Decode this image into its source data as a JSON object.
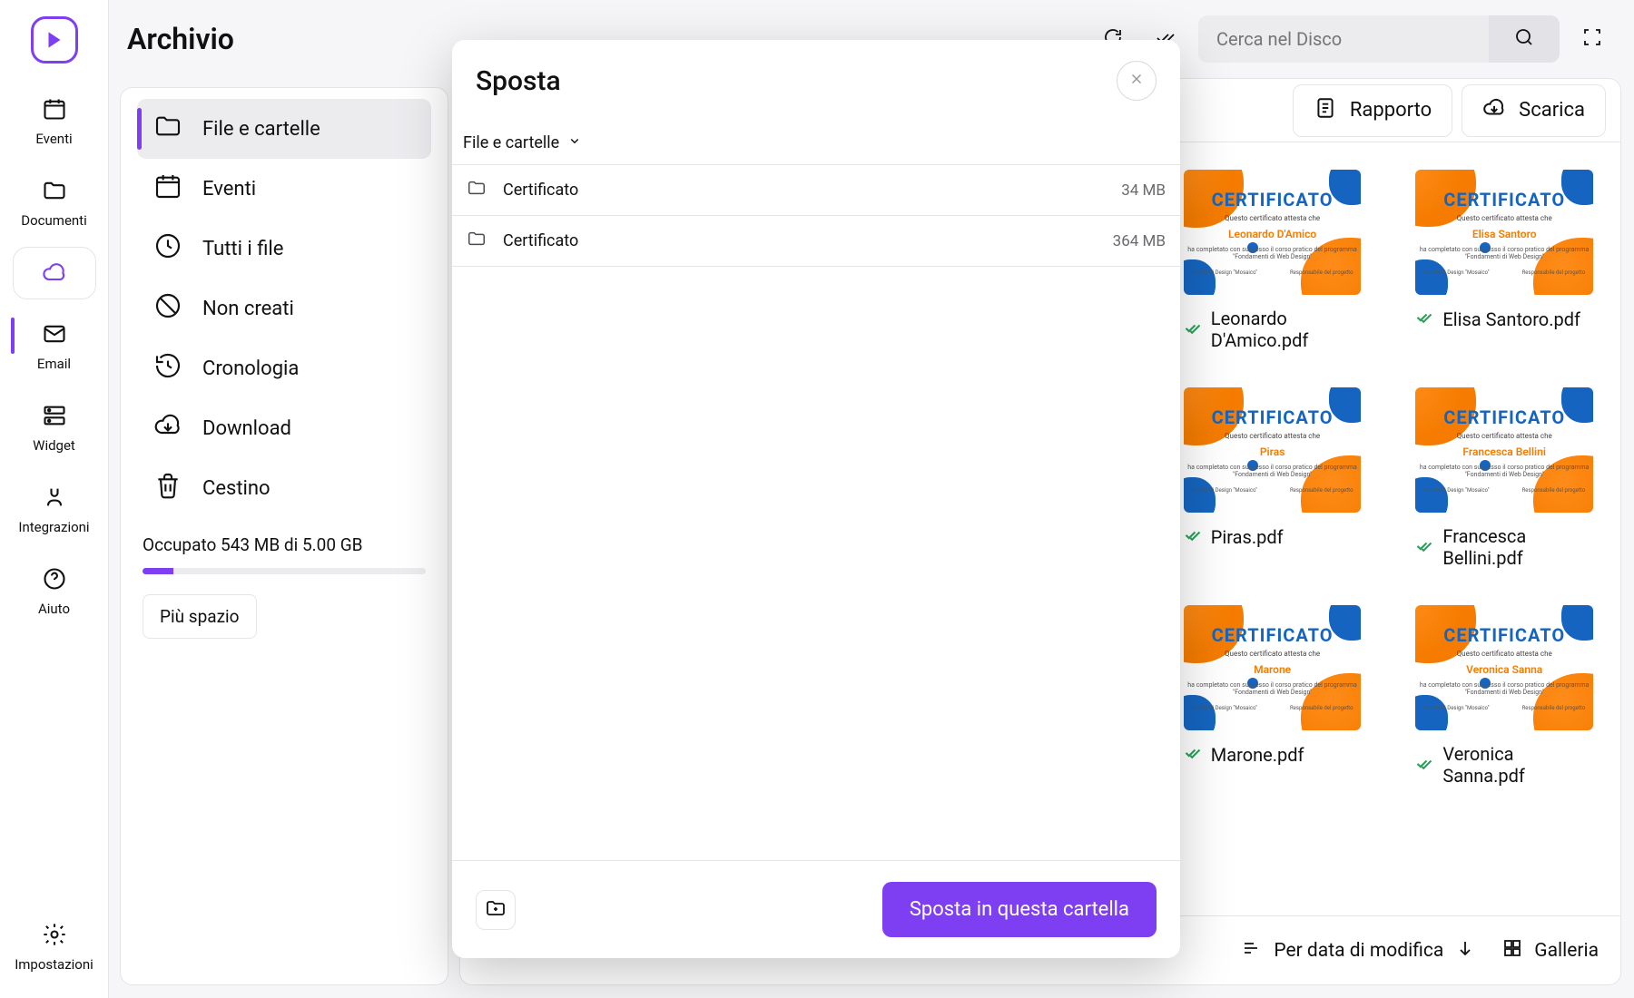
{
  "header": {
    "page_title": "Archivio",
    "search_placeholder": "Cerca nel Disco",
    "report_label": "Rapporto",
    "download_label": "Scarica"
  },
  "primary_nav": {
    "items": [
      {
        "key": "eventi",
        "label": "Eventi"
      },
      {
        "key": "documenti",
        "label": "Documenti"
      },
      {
        "key": "archivio",
        "label": ""
      },
      {
        "key": "email",
        "label": "Email"
      },
      {
        "key": "widget",
        "label": "Widget"
      },
      {
        "key": "integrazioni",
        "label": "Integrazioni"
      },
      {
        "key": "aiuto",
        "label": "Aiuto"
      }
    ],
    "settings_label": "Impostazioni"
  },
  "secondary_nav": {
    "items": [
      {
        "label": "File e cartelle"
      },
      {
        "label": "Eventi"
      },
      {
        "label": "Tutti i file"
      },
      {
        "label": "Non creati"
      },
      {
        "label": "Cronologia"
      },
      {
        "label": "Download"
      },
      {
        "label": "Cestino"
      }
    ],
    "storage_text": "Occupato 543 MB di 5.00 GB",
    "more_space": "Più spazio"
  },
  "content": {
    "sort_label": "Per data di modifica",
    "view_label": "Galleria",
    "files_visible": [
      {
        "person": "Leonardo D'Amico",
        "filename": "Leonardo D'Amico.pdf"
      },
      {
        "person": "Elisa Santoro",
        "filename": "Elisa Santoro.pdf"
      },
      {
        "person": "Piras",
        "filename": "Piras.pdf"
      },
      {
        "person": "Francesca Bellini",
        "filename": "Francesca Bellini.pdf"
      },
      {
        "person": "Marone",
        "filename": "Marone.pdf"
      },
      {
        "person": "Veronica Sanna",
        "filename": "Veronica Sanna.pdf"
      }
    ],
    "cert_strings": {
      "title": "CERTIFICATO",
      "sub": "Questo certificato attesta che",
      "line": "ha completato con successo il corso pratico del programma \"Fondamenti di Web Design\"",
      "foot_left": "Scuola di Design \"Mosaico\"",
      "foot_right": "Responsabile del progetto"
    }
  },
  "modal": {
    "title": "Sposta",
    "breadcrumb": "File e cartelle",
    "rows": [
      {
        "name": "Certificato",
        "size": "34 MB"
      },
      {
        "name": "Certificato",
        "size": "364 MB"
      }
    ],
    "primary_label": "Sposta in questa cartella"
  }
}
